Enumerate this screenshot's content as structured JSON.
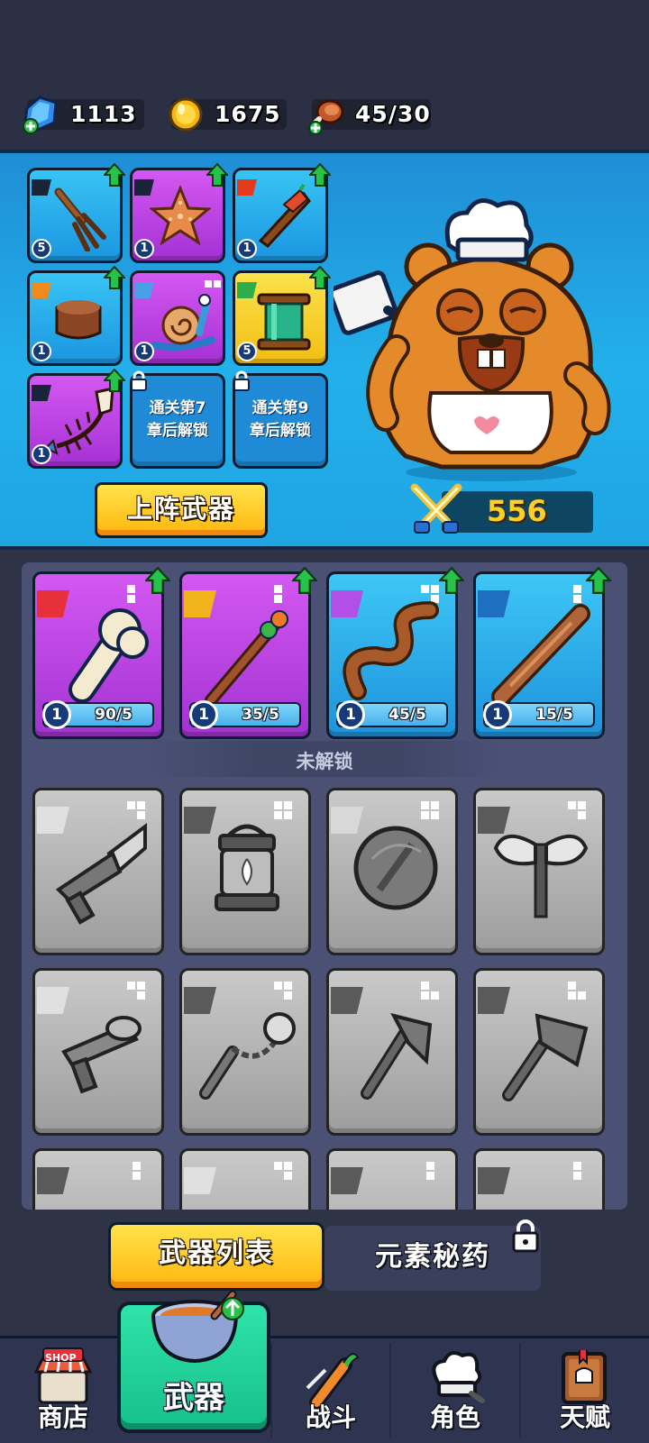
{
  "currencies": {
    "gems": "1113",
    "coins": "1675",
    "stamina": "45/30"
  },
  "equipped": {
    "slots": [
      {
        "name": "fork",
        "level": "5",
        "rarity": "blue",
        "element": "sword"
      },
      {
        "name": "starfish",
        "level": "1",
        "rarity": "purple",
        "element": "sword"
      },
      {
        "name": "knife-with-pepper",
        "level": "1",
        "rarity": "blue",
        "element": "fire"
      },
      {
        "name": "wood-block",
        "level": "1",
        "rarity": "blue",
        "element": "shield"
      },
      {
        "name": "snail",
        "level": "1",
        "rarity": "purple",
        "element": "wind"
      },
      {
        "name": "scroll",
        "level": "5",
        "rarity": "yellow",
        "element": "leaf"
      },
      {
        "name": "fish-bone",
        "level": "1",
        "rarity": "purple",
        "element": "sword"
      }
    ],
    "locked_slots": [
      {
        "text_line1": "通关第7",
        "text_line2": "章后解锁"
      },
      {
        "text_line1": "通关第9",
        "text_line2": "章后解锁"
      }
    ],
    "deploy_button": "上阵武器",
    "power": "556"
  },
  "weapons": {
    "owned": [
      {
        "name": "bone",
        "rarity": "purple",
        "element_color": "#e8303a",
        "level": "1",
        "progress": "90/5"
      },
      {
        "name": "kebab-staff",
        "rarity": "purple",
        "element_color": "#f2b41c",
        "level": "1",
        "progress": "35/5"
      },
      {
        "name": "sausage-whip",
        "rarity": "blue",
        "element_color": "#b24fe6",
        "level": "1",
        "progress": "45/5"
      },
      {
        "name": "rolling-pin",
        "rarity": "blue",
        "element_color": "#1e6fc0",
        "level": "1",
        "progress": "15/5"
      }
    ],
    "locked_label": "未解锁",
    "locked": [
      {
        "name": "corn-gun"
      },
      {
        "name": "lantern"
      },
      {
        "name": "round-shield"
      },
      {
        "name": "double-axe"
      },
      {
        "name": "fish-gun"
      },
      {
        "name": "nunchaku"
      },
      {
        "name": "hatchet"
      },
      {
        "name": "cleaver"
      },
      {
        "name": "locked-9"
      },
      {
        "name": "locked-10"
      },
      {
        "name": "locked-11"
      },
      {
        "name": "locked-12"
      }
    ]
  },
  "tabs": {
    "weapon_list": "武器列表",
    "elixir": "元素秘药"
  },
  "nav": {
    "shop": "商店",
    "shop_sign": "SHOP",
    "weapon": "武器",
    "battle": "战斗",
    "character": "角色",
    "talent": "天赋"
  },
  "colors": {
    "accent_yellow": "#ffc21a",
    "nav_active_green": "#1fd39a",
    "upgrade_green": "#27c24a"
  }
}
